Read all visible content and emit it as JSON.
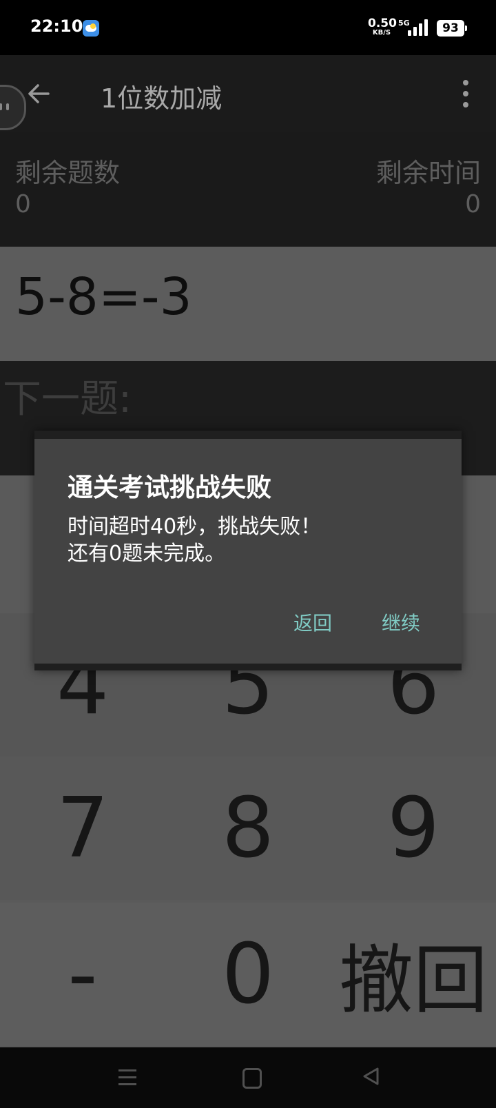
{
  "status_bar": {
    "time": "22:10",
    "weather_icon": "weather-sun-cloud-icon",
    "net_speed_value": "0.50",
    "net_speed_unit": "KB/S",
    "network_type": "5G",
    "battery": "93"
  },
  "toolbar": {
    "title": "1位数加减"
  },
  "stats": {
    "remaining_questions_label": "剩余题数",
    "remaining_questions_value": "0",
    "remaining_time_label": "剩余时间",
    "remaining_time_value": "0"
  },
  "question": {
    "current": "5-8=-3",
    "next_label": "下一题:"
  },
  "keypad": {
    "keys": [
      "4",
      "5",
      "6",
      "7",
      "8",
      "9",
      "-",
      "0",
      "撤回"
    ]
  },
  "dialog": {
    "title": "通关考试挑战失败",
    "message_line1": "时间超时40秒，挑战失败！",
    "message_line2": "还有0题未完成。",
    "return_button": "返回",
    "continue_button": "继续",
    "button_color": "#80cbc4"
  }
}
